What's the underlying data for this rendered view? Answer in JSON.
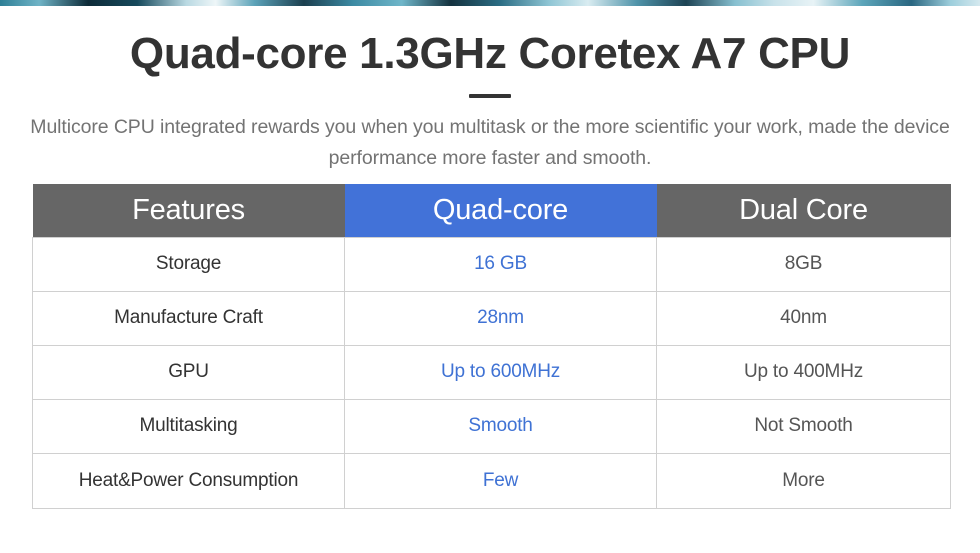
{
  "header": {
    "title": "Quad-core 1.3GHz Coretex A7 CPU",
    "subtitle": "Multicore CPU integrated rewards you when you multitask or the more scientific your work, made the device performance more faster and smooth."
  },
  "colors": {
    "header_gray": "#666666",
    "header_highlight_blue": "#4272d8",
    "highlight_text_blue": "#3f72d4",
    "title_text": "#333333",
    "subtitle_text": "#737373",
    "dual_text": "#555555",
    "table_border": "#d0d0d0"
  },
  "table": {
    "columns": [
      {
        "label": "Features",
        "style": "plain"
      },
      {
        "label": "Quad-core",
        "style": "highlight"
      },
      {
        "label": "Dual Core",
        "style": "plain"
      }
    ],
    "rows": [
      {
        "feature": "Storage",
        "quad": "16 GB",
        "dual": "8GB"
      },
      {
        "feature": "Manufacture Craft",
        "quad": "28nm",
        "dual": "40nm"
      },
      {
        "feature": "GPU",
        "quad": "Up to 600MHz",
        "dual": "Up to 400MHz"
      },
      {
        "feature": "Multitasking",
        "quad": "Smooth",
        "dual": "Not Smooth"
      },
      {
        "feature": "Heat&Power Consumption",
        "quad": "Few",
        "dual": "More"
      }
    ]
  }
}
